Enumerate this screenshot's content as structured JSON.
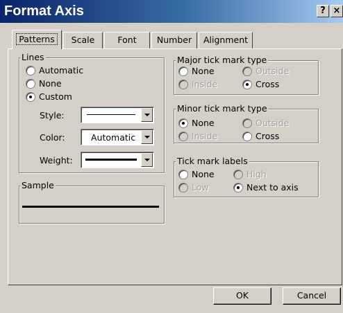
{
  "window": {
    "title": "Format Axis",
    "help_label": "?",
    "close_label": "×"
  },
  "tabs": [
    {
      "label": "Patterns",
      "active": true
    },
    {
      "label": "Scale"
    },
    {
      "label": "Font"
    },
    {
      "label": "Number"
    },
    {
      "label": "Alignment"
    }
  ],
  "lines": {
    "legend": "Lines",
    "options": [
      {
        "label": "Automatic",
        "selected": false
      },
      {
        "label": "None",
        "selected": false
      },
      {
        "label": "Custom",
        "selected": true
      }
    ],
    "style_label": "Style:",
    "color_label": "Color:",
    "color_value": "Automatic",
    "weight_label": "Weight:"
  },
  "sample": {
    "legend": "Sample"
  },
  "major_tick": {
    "legend": "Major tick mark type",
    "options": [
      {
        "label": "None",
        "selected": false,
        "enabled": true
      },
      {
        "label": "Outside",
        "selected": false,
        "enabled": false
      },
      {
        "label": "Inside",
        "selected": false,
        "enabled": false
      },
      {
        "label": "Cross",
        "selected": true,
        "enabled": true
      }
    ]
  },
  "minor_tick": {
    "legend": "Minor tick mark type",
    "options": [
      {
        "label": "None",
        "selected": true,
        "enabled": true
      },
      {
        "label": "Outside",
        "selected": false,
        "enabled": false
      },
      {
        "label": "Inside",
        "selected": false,
        "enabled": false
      },
      {
        "label": "Cross",
        "selected": false,
        "enabled": true
      }
    ]
  },
  "tick_labels": {
    "legend": "Tick mark labels",
    "options": [
      {
        "label": "None",
        "selected": false,
        "enabled": true
      },
      {
        "label": "High",
        "selected": false,
        "enabled": false
      },
      {
        "label": "Low",
        "selected": false,
        "enabled": false
      },
      {
        "label": "Next to axis",
        "selected": true,
        "enabled": true
      }
    ]
  },
  "buttons": {
    "ok": "OK",
    "cancel": "Cancel"
  }
}
